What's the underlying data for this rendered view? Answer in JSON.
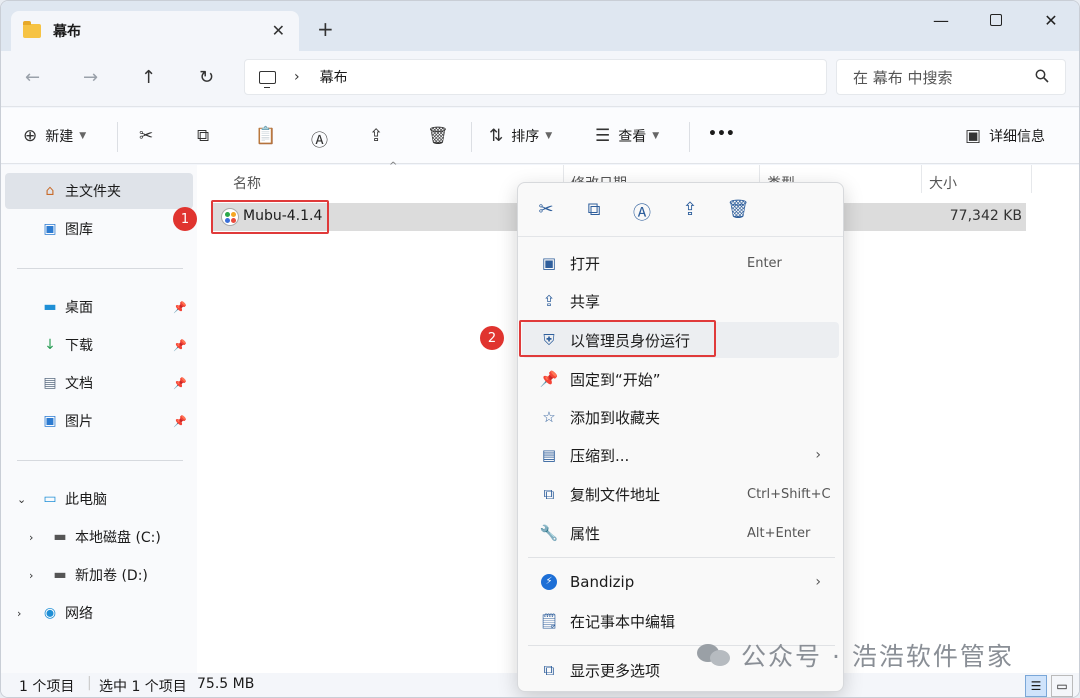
{
  "window": {
    "tab_title": "幕布",
    "tab_close": "✕",
    "new_tab": "+",
    "minimize": "—",
    "close": "✕"
  },
  "nav": {
    "back": "←",
    "forward": "→",
    "up": "↑",
    "refresh": "↻",
    "crumb_sep": "›",
    "crumb": "幕布",
    "search_placeholder": "在 幕布 中搜索"
  },
  "toolbar": {
    "new_label": "新建",
    "sort_label": "排序",
    "view_label": "查看",
    "more": "•••",
    "details_label": "详细信息"
  },
  "sidebar": {
    "home": "主文件夹",
    "gallery": "图库",
    "pinned": [
      "桌面",
      "下载",
      "文档",
      "图片"
    ],
    "this_pc": "此电脑",
    "drives": [
      "本地磁盘 (C:)",
      "新加卷 (D:)"
    ],
    "network": "网络"
  },
  "columns": {
    "name": "名称",
    "date": "修改日期",
    "type": "类型",
    "size": "大小"
  },
  "file": {
    "name": "Mubu-4.1.4",
    "size": "77,342 KB"
  },
  "annotations": {
    "step1": "1",
    "step2": "2"
  },
  "context_menu": {
    "items": [
      {
        "label": "打开",
        "shortcut": "Enter"
      },
      {
        "label": "共享",
        "shortcut": ""
      },
      {
        "label": "以管理员身份运行",
        "shortcut": ""
      },
      {
        "label": "固定到“开始”",
        "shortcut": ""
      },
      {
        "label": "添加到收藏夹",
        "shortcut": ""
      },
      {
        "label": "压缩到...",
        "shortcut": ""
      },
      {
        "label": "复制文件地址",
        "shortcut": "Ctrl+Shift+C"
      },
      {
        "label": "属性",
        "shortcut": "Alt+Enter"
      },
      {
        "label": "Bandizip",
        "shortcut": ""
      },
      {
        "label": "在记事本中编辑",
        "shortcut": ""
      },
      {
        "label": "显示更多选项",
        "shortcut": ""
      }
    ]
  },
  "status": {
    "count": "1 个项目",
    "selected": "选中 1 个项目",
    "size": "75.5 MB"
  },
  "watermark": "公众号 · 浩浩软件管家",
  "colors": {
    "accent": "#2f5f9c",
    "annotation_red": "#e03a3a",
    "selection": "#dcdcdc"
  }
}
